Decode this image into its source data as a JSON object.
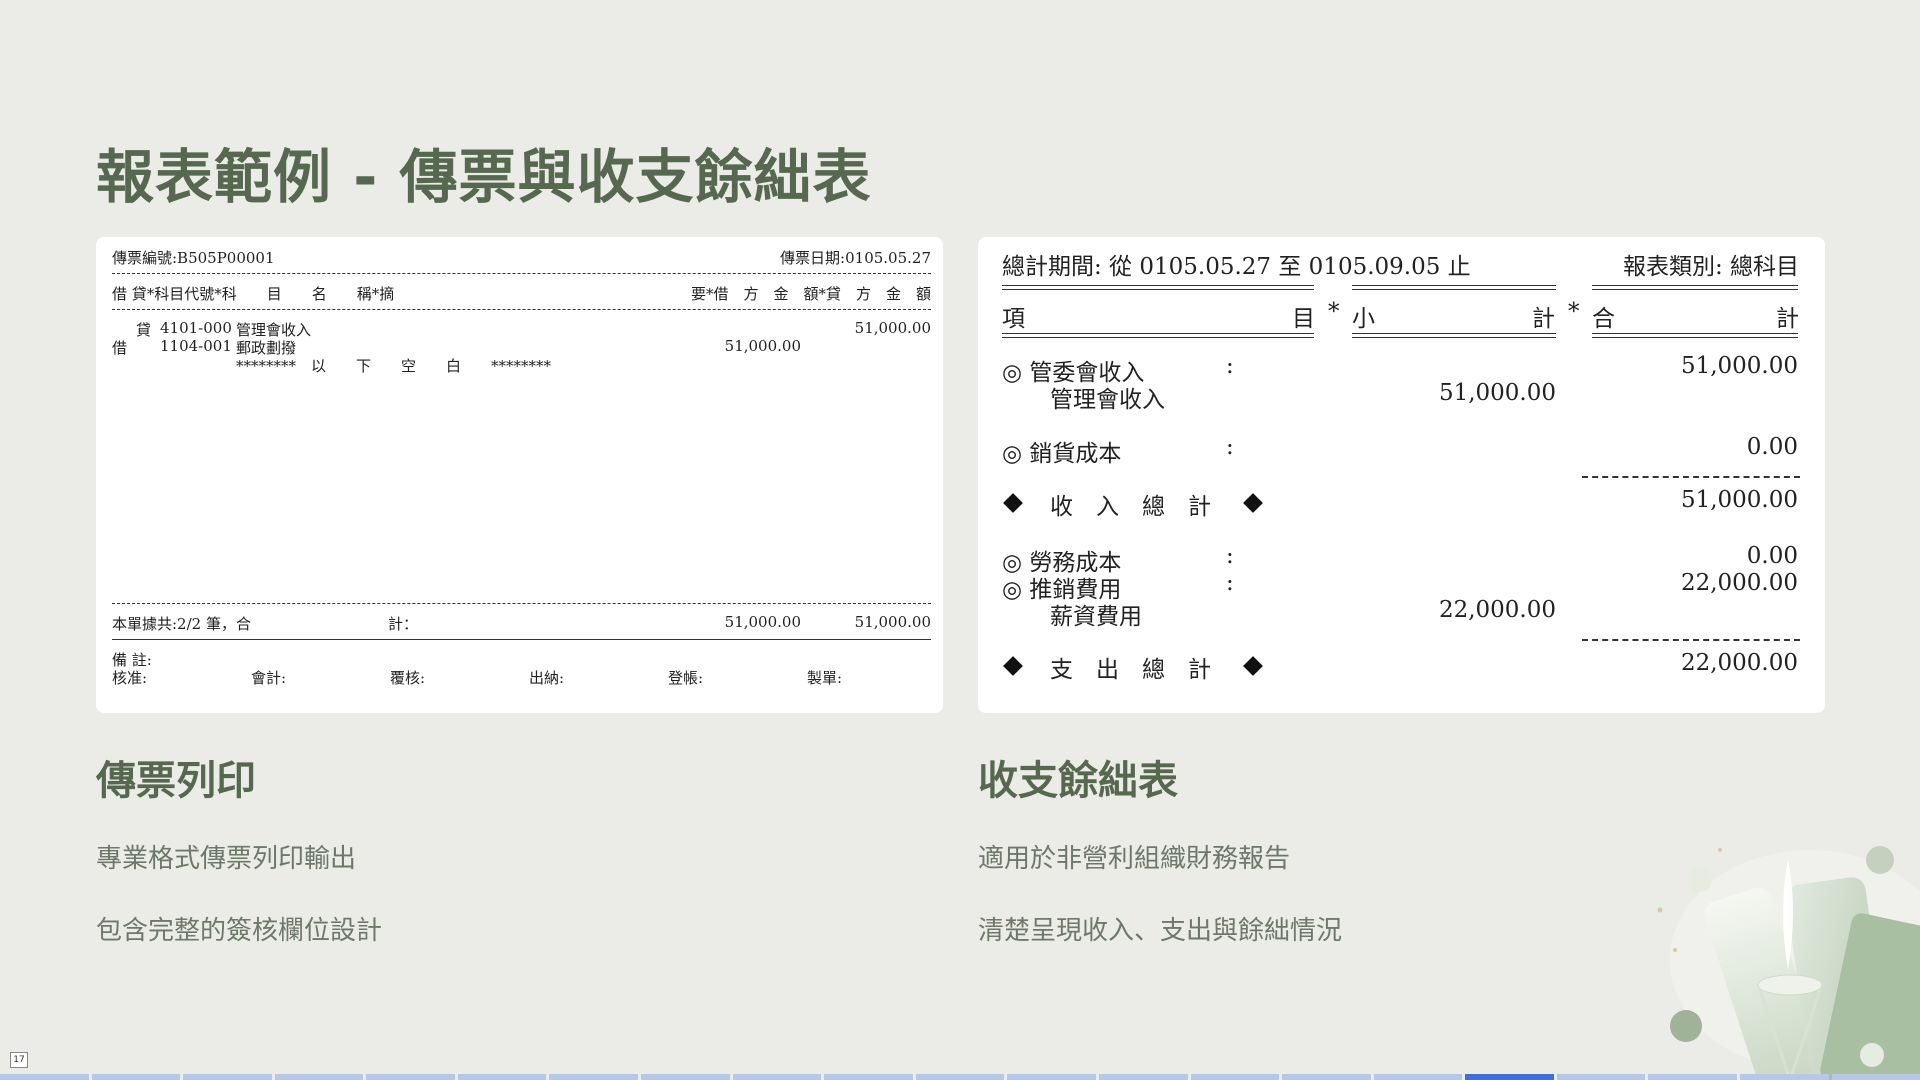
{
  "slide": {
    "title": "報表範例 - 傳票與收支餘絀表",
    "page_number": "17"
  },
  "voucher": {
    "number_label": "傳票編號:B505P00001",
    "date_label": "傳票日期:0105.05.27",
    "header_cols": "借 貸*科目代號*科　　目　　名　　稱*摘",
    "header_right": "要*借　方　金　額*貸　方　金　額",
    "rows": [
      {
        "dc": "貸",
        "code": "4101-000",
        "name": "管理會收入",
        "debit": "",
        "credit": "51,000.00"
      },
      {
        "dc": "借",
        "code": "1104-001",
        "name": "郵政劃撥",
        "debit": "51,000.00",
        "credit": ""
      }
    ],
    "blank_marker": "********　以　　下　　空　　白　　********",
    "total_label": "本單據共:2/2 筆，合",
    "total_mid": "計：",
    "total_debit": "51,000.00",
    "total_credit": "51,000.00",
    "remark_label": "備 註:",
    "signatures": [
      "核准:",
      "會計:",
      "覆核:",
      "出納:",
      "登帳:",
      "製單:"
    ]
  },
  "report": {
    "period_label": "總計期間: 從 0105.05.27 至 0105.09.05 止",
    "type_label": "報表類別: 總科目",
    "col_item_a": "項",
    "col_item_b": "目",
    "col_sub_a": "小",
    "col_sub_b": "計",
    "col_total_a": "合",
    "col_total_b": "計",
    "col_sep": "*",
    "lines": {
      "l1_label": "◎ 管委會收入",
      "l1_total": "51,000.00",
      "l1_sub_label": "管理會收入",
      "l1_sub": "51,000.00",
      "l2_label": "◎ 銷貨成本",
      "l2_total": "0.00",
      "income_total_label": "收　入　總　計",
      "income_total": "51,000.00",
      "l3_label": "◎ 勞務成本",
      "l3_total": "0.00",
      "l4_label": "◎ 推銷費用",
      "l4_total": "22,000.00",
      "l4_sub_label": "薪資費用",
      "l4_sub": "22,000.00",
      "expense_total_label": "支　出　總　計",
      "expense_total": "22,000.00",
      "colon": ":"
    }
  },
  "left_section": {
    "heading": "傳票列印",
    "bullets": [
      "專業格式傳票列印輸出",
      "包含完整的簽核欄位設計"
    ]
  },
  "right_section": {
    "heading": "收支餘絀表",
    "bullets": [
      "適用於非營利組織財務報告",
      "清楚呈現收入、支出與餘絀情況"
    ]
  },
  "progress": {
    "total_segments": 21,
    "active_index": 16
  }
}
